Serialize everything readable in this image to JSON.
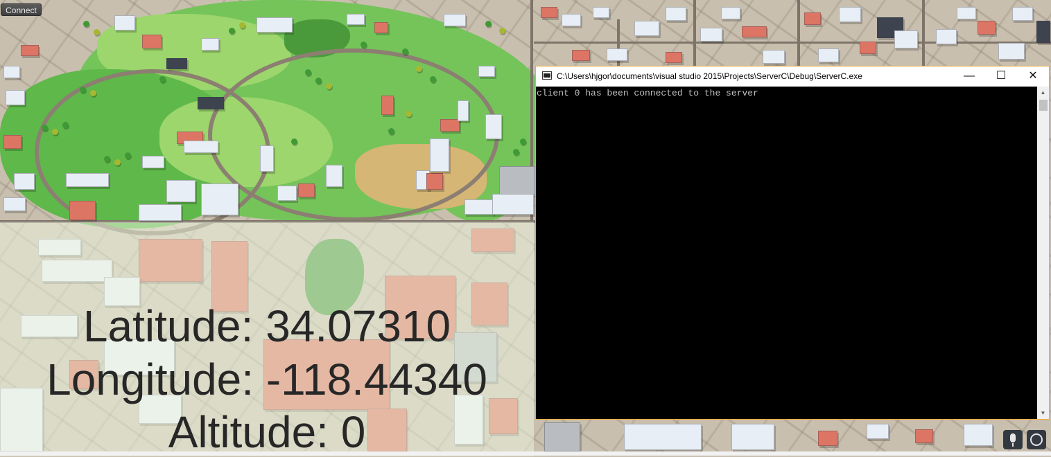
{
  "toolbar": {
    "connect_label": "Connect"
  },
  "map": {
    "latitude_text": "Latitude: 34.07310",
    "longitude_text": "Longitude: -118.44340",
    "altitude_text": "Altitude: 0"
  },
  "console": {
    "title": "C:\\Users\\hjgor\\documents\\visual studio 2015\\Projects\\ServerC\\Debug\\ServerC.exe",
    "output": "client 0 has been connected to the server",
    "minimize_glyph": "—",
    "maximize_glyph": "☐",
    "close_glyph": "✕",
    "scroll_up_glyph": "▲",
    "scroll_down_glyph": "▼"
  },
  "icons": {
    "app": "console-app-icon",
    "microphone": "microphone-icon",
    "cortana": "cortana-icon"
  },
  "colors": {
    "console_border": "#f0a830",
    "console_background": "#000000",
    "console_text": "#c0c0c0",
    "park_green": "#74c45a",
    "roof_red": "#dd7565"
  }
}
